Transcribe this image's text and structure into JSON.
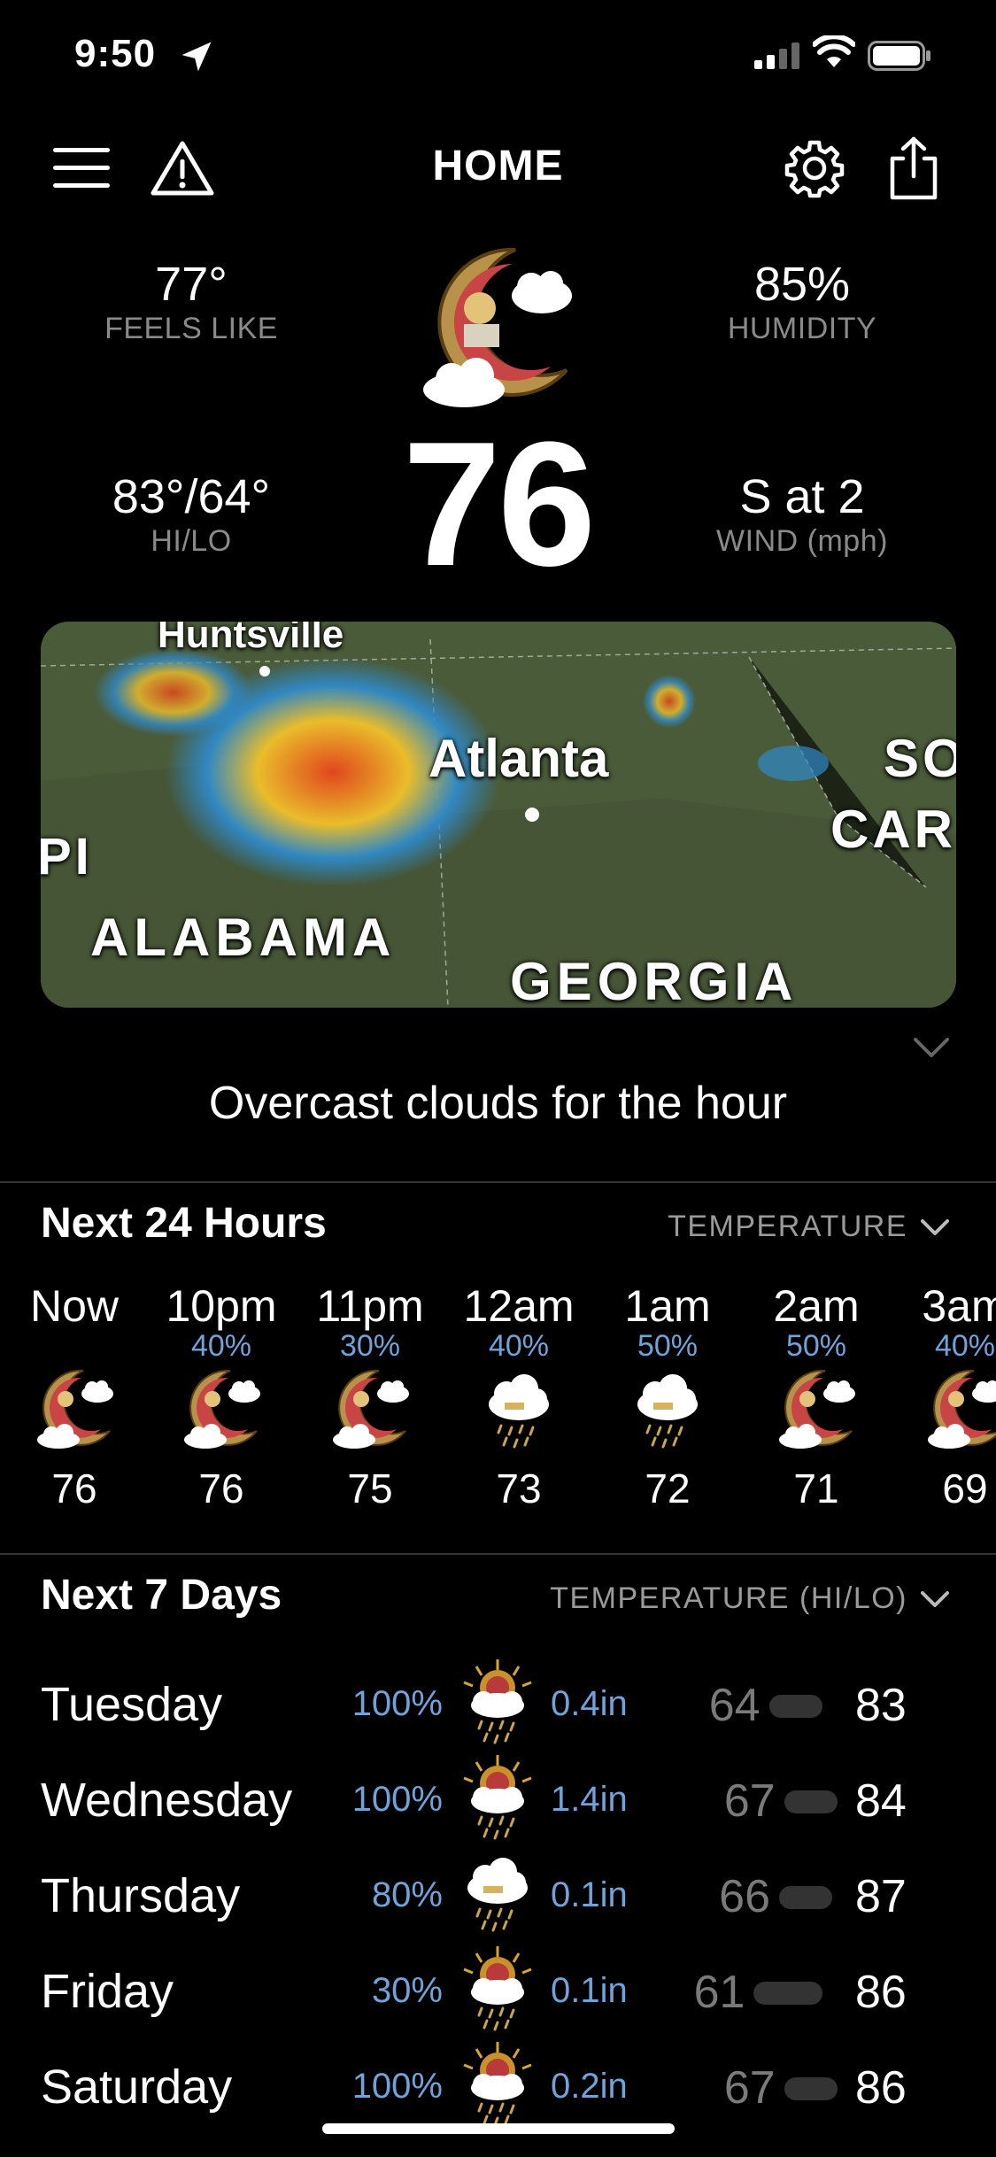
{
  "status_bar": {
    "time": "9:50"
  },
  "header": {
    "title": "HOME"
  },
  "current": {
    "feels_like": {
      "value": "77°",
      "label": "FEELS LIKE"
    },
    "humidity": {
      "value": "85%",
      "label": "HUMIDITY"
    },
    "hilo": {
      "value": "83°/64°",
      "label": "HI/LO"
    },
    "wind": {
      "value": "S at 2",
      "label": "WIND (mph)"
    },
    "temperature": "76"
  },
  "map": {
    "labels": [
      "Huntsville",
      "Atlanta",
      "SO",
      "CAR",
      "PI",
      "ALABAMA",
      "GEORGIA"
    ]
  },
  "summary": "Overcast clouds for the hour",
  "hourly": {
    "title": "Next 24 Hours",
    "selector": "TEMPERATURE",
    "items": [
      {
        "time": "Now",
        "pop": "",
        "temp": "76",
        "icon": "moon-cloud-icon"
      },
      {
        "time": "10pm",
        "pop": "40%",
        "temp": "76",
        "icon": "moon-cloud-icon"
      },
      {
        "time": "11pm",
        "pop": "30%",
        "temp": "75",
        "icon": "moon-cloud-icon"
      },
      {
        "time": "12am",
        "pop": "40%",
        "temp": "73",
        "icon": "rain-cloud-icon"
      },
      {
        "time": "1am",
        "pop": "50%",
        "temp": "72",
        "icon": "rain-cloud-icon"
      },
      {
        "time": "2am",
        "pop": "50%",
        "temp": "71",
        "icon": "moon-cloud-icon"
      },
      {
        "time": "3am",
        "pop": "40%",
        "temp": "69",
        "icon": "moon-cloud-icon"
      }
    ]
  },
  "daily": {
    "title": "Next 7 Days",
    "selector": "TEMPERATURE (HI/LO)",
    "items": [
      {
        "day": "Tuesday",
        "pop": "100%",
        "precip": "0.4in",
        "lo": "64",
        "hi": "83",
        "icon": "sun-rain-icon"
      },
      {
        "day": "Wednesday",
        "pop": "100%",
        "precip": "1.4in",
        "lo": "67",
        "hi": "84",
        "icon": "sun-rain-icon"
      },
      {
        "day": "Thursday",
        "pop": "80%",
        "precip": "0.1in",
        "lo": "66",
        "hi": "87",
        "icon": "rain-cloud-icon"
      },
      {
        "day": "Friday",
        "pop": "30%",
        "precip": "0.1in",
        "lo": "61",
        "hi": "86",
        "icon": "sun-rain-icon"
      },
      {
        "day": "Saturday",
        "pop": "100%",
        "precip": "0.2in",
        "lo": "67",
        "hi": "86",
        "icon": "sun-rain-icon"
      }
    ]
  },
  "colors": {
    "accent_blue": "#6fa3d9",
    "muted": "#8a8a8a",
    "background": "#000000"
  }
}
